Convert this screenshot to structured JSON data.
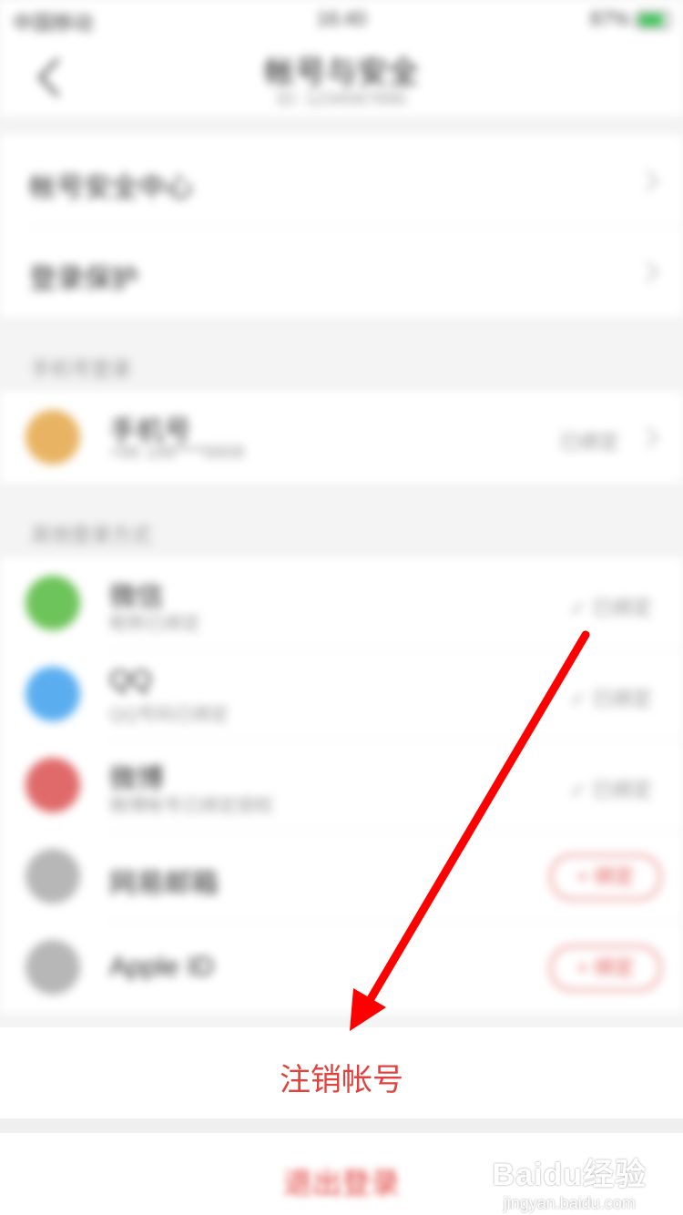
{
  "status_bar": {
    "carrier": "中国移动",
    "time": "16:40",
    "battery_text": "87%",
    "battery_level": 0.87
  },
  "nav": {
    "title": "帐号与安全",
    "subtitle": "ID: 1234567890"
  },
  "settings": [
    {
      "label": "帐号安全中心"
    },
    {
      "label": "登录保护"
    }
  ],
  "phone_section": {
    "header": "手机号登录",
    "item": {
      "name": "手机号",
      "sub": "+86 188****6808",
      "status": "已绑定"
    }
  },
  "social_section": {
    "header": "其他登录方式",
    "items": [
      {
        "name": "微信",
        "sub": "昵称已绑定",
        "status": "✓ 已绑定",
        "color": "#6dc45a",
        "icon": "wechat-icon"
      },
      {
        "name": "QQ",
        "sub": "QQ号码已绑定",
        "status": "✓ 已绑定",
        "color": "#5aaef0",
        "icon": "qq-icon"
      },
      {
        "name": "微博",
        "sub": "微博帐号已绑定授权",
        "status": "✓ 已绑定",
        "color": "#e06a6a",
        "icon": "weibo-icon"
      },
      {
        "name": "网易邮箱",
        "action": "+ 绑定",
        "color": "#b7b7b7",
        "icon": "mail-icon"
      },
      {
        "name": "Apple ID",
        "action": "+ 绑定",
        "color": "#b7b7b7",
        "icon": "apple-icon"
      }
    ]
  },
  "action_sheet": {
    "primary": "注销帐号",
    "secondary": "退出登录"
  },
  "watermark": {
    "logo": "Baidu经验",
    "url": "jingyan.baidu.com"
  },
  "colors": {
    "danger": "#e0423d",
    "arrow": "#ff0000"
  }
}
